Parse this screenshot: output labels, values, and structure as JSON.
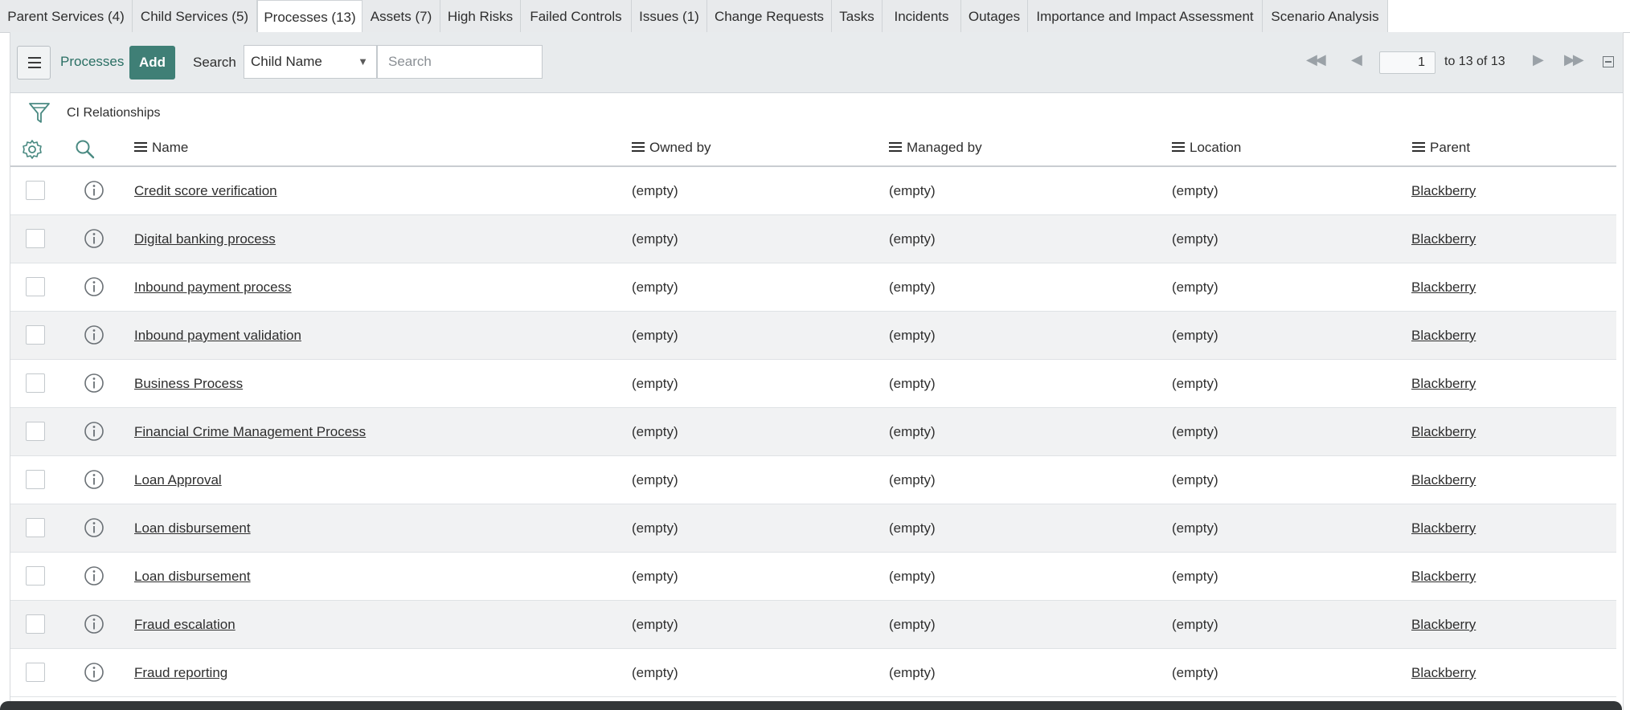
{
  "tabs": [
    {
      "label": "Parent Services (4)",
      "active": false
    },
    {
      "label": "Child Services (5)",
      "active": false
    },
    {
      "label": "Processes (13)",
      "active": true
    },
    {
      "label": "Assets (7)",
      "active": false
    },
    {
      "label": "High Risks",
      "active": false
    },
    {
      "label": "Failed Controls",
      "active": false
    },
    {
      "label": "Issues (1)",
      "active": false
    },
    {
      "label": "Change Requests",
      "active": false
    },
    {
      "label": "Tasks",
      "active": false
    },
    {
      "label": "Incidents",
      "active": false
    },
    {
      "label": "Outages",
      "active": false
    },
    {
      "label": "Importance and Impact Assessment",
      "active": false
    },
    {
      "label": "Scenario Analysis",
      "active": false
    }
  ],
  "toolbar": {
    "list_title": "Processes",
    "add_label": "Add",
    "search_label": "Search",
    "search_field": "Child Name",
    "search_placeholder": "Search"
  },
  "pager": {
    "current_page": "1",
    "range_text": "to 13 of 13"
  },
  "breadcrumb": "CI Relationships",
  "columns": [
    "Name",
    "Owned by",
    "Managed by",
    "Location",
    "Parent"
  ],
  "rows": [
    {
      "name": "Credit score verification",
      "owned_by": "(empty)",
      "managed_by": "(empty)",
      "location": "(empty)",
      "parent": "Blackberry"
    },
    {
      "name": "Digital banking process",
      "owned_by": "(empty)",
      "managed_by": "(empty)",
      "location": "(empty)",
      "parent": "Blackberry"
    },
    {
      "name": "Inbound payment process",
      "owned_by": "(empty)",
      "managed_by": "(empty)",
      "location": "(empty)",
      "parent": "Blackberry"
    },
    {
      "name": "Inbound payment validation",
      "owned_by": "(empty)",
      "managed_by": "(empty)",
      "location": "(empty)",
      "parent": "Blackberry"
    },
    {
      "name": "Business Process",
      "owned_by": "(empty)",
      "managed_by": "(empty)",
      "location": "(empty)",
      "parent": "Blackberry"
    },
    {
      "name": "Financial Crime Management Process",
      "owned_by": "(empty)",
      "managed_by": "(empty)",
      "location": "(empty)",
      "parent": "Blackberry"
    },
    {
      "name": "Loan Approval",
      "owned_by": "(empty)",
      "managed_by": "(empty)",
      "location": "(empty)",
      "parent": "Blackberry"
    },
    {
      "name": "Loan disbursement",
      "owned_by": "(empty)",
      "managed_by": "(empty)",
      "location": "(empty)",
      "parent": "Blackberry"
    },
    {
      "name": "Loan disbursement",
      "owned_by": "(empty)",
      "managed_by": "(empty)",
      "location": "(empty)",
      "parent": "Blackberry"
    },
    {
      "name": "Fraud escalation",
      "owned_by": "(empty)",
      "managed_by": "(empty)",
      "location": "(empty)",
      "parent": "Blackberry"
    },
    {
      "name": "Fraud reporting",
      "owned_by": "(empty)",
      "managed_by": "(empty)",
      "location": "(empty)",
      "parent": "Blackberry"
    }
  ],
  "icons": {
    "list_menu": "hamburger-icon",
    "filter": "funnel-icon",
    "settings": "gear-icon",
    "column_search": "search-icon",
    "row_preview": "info-icon",
    "pager_first": "double-left-icon",
    "pager_prev": "left-icon",
    "pager_next": "right-icon",
    "pager_last": "double-right-icon",
    "collapse": "collapse-icon"
  },
  "colors": {
    "accent": "#3f7f76",
    "title_text": "#2a6f64",
    "toolbar_bg": "#e8ebed",
    "row_alt_bg": "#f1f2f3"
  }
}
